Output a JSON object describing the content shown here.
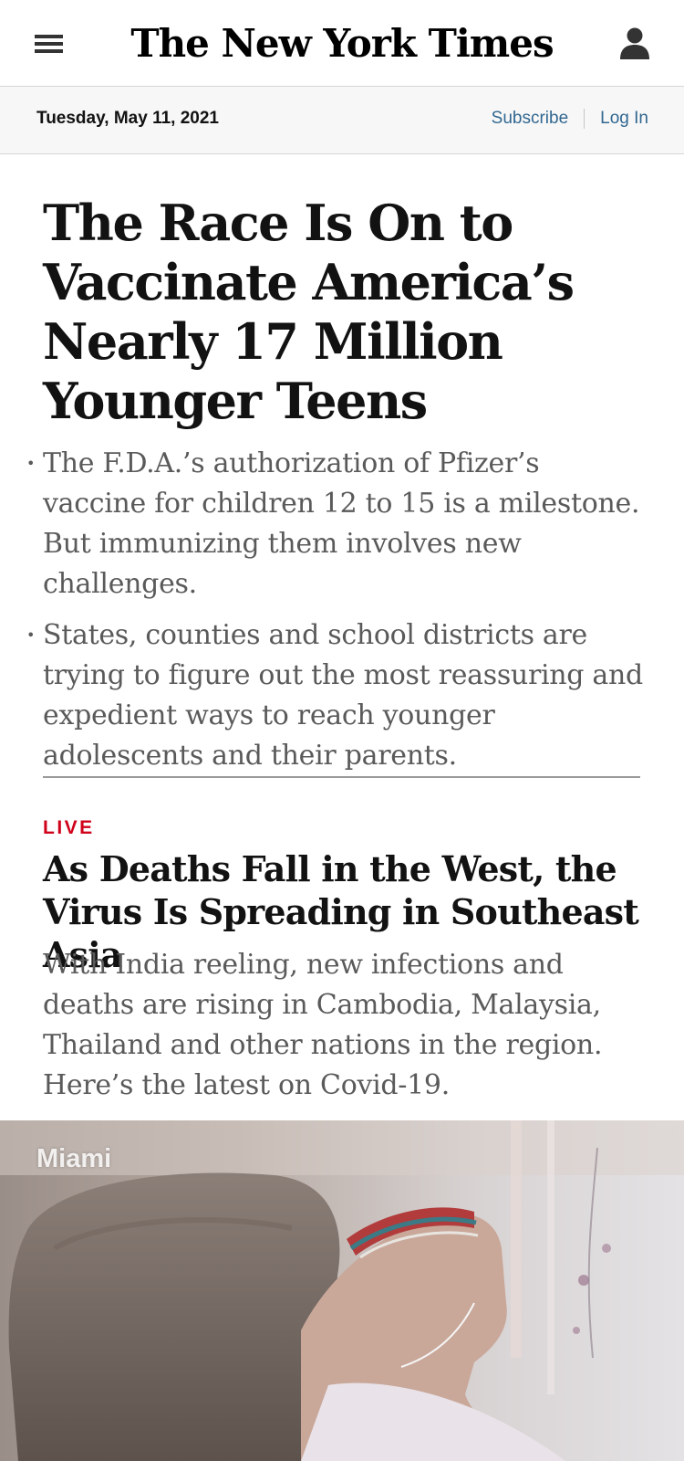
{
  "masthead": {
    "logo": "The New York Times",
    "menu_icon": "hamburger-menu-icon",
    "account_icon": "user-account-icon"
  },
  "datebar": {
    "date": "Tuesday, May 11, 2021",
    "subscribe": "Subscribe",
    "login": "Log In"
  },
  "lead_story": {
    "headline": "The Race Is On to Vaccinate America’s Nearly 17 Million Younger Teens",
    "bullets": [
      "The F.D.A.’s authorization of Pfizer’s vaccine for children 12 to 15 is a milestone. But immunizing them involves new challenges.",
      "States, counties and school districts are trying to figure out the most reassuring and expedient ways to reach younger adolescents and their parents."
    ]
  },
  "second_story": {
    "kicker": "LIVE",
    "headline": "As Deaths Fall in the West, the Virus Is Spreading in Southeast Asia",
    "summary": "With India reeling, new infections and deaths are rising in Cambodia, Malaysia, Thailand and other nations in the region. Here’s the latest on Covid-19."
  },
  "photo": {
    "caption": "Miami"
  },
  "colors": {
    "link_blue": "#326891",
    "live_red": "#d0021b",
    "summary_gray": "#5a5a5a",
    "datebar_bg": "#f7f7f7"
  }
}
